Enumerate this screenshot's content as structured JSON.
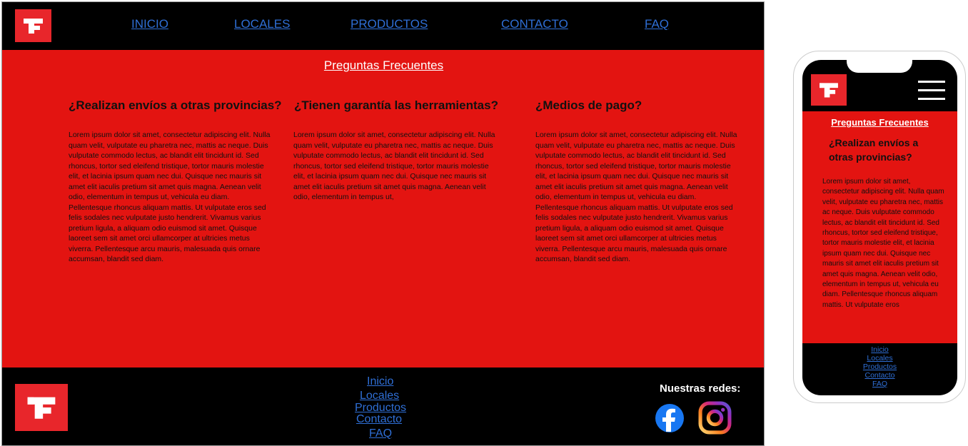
{
  "colors": {
    "brand_red": "#e31411",
    "logo_red": "#e8262b",
    "header_bg": "#000000",
    "link_blue": "#2f6fd6"
  },
  "nav": {
    "items": [
      "INICIO",
      "LOCALES",
      "PRODUCTOS",
      "CONTACTO",
      "FAQ"
    ]
  },
  "main": {
    "title": "Preguntas Frecuentes",
    "questions": [
      {
        "q": "¿Realizan envíos a otras provincias?",
        "a": "Lorem ipsum dolor sit amet, consectetur adipiscing elit. Nulla quam velit, vulputate eu pharetra nec, mattis ac neque. Duis vulputate commodo lectus, ac blandit elit tincidunt id. Sed rhoncus, tortor sed eleifend tristique, tortor mauris molestie elit, et lacinia ipsum quam nec dui. Quisque nec mauris sit amet elit iaculis pretium sit amet quis magna. Aenean velit odio, elementum in tempus ut, vehicula eu diam. Pellentesque rhoncus aliquam mattis. Ut vulputate eros sed felis sodales nec vulputate justo hendrerit. Vivamus varius pretium ligula, a aliquam odio euismod sit amet. Quisque laoreet sem sit amet orci ullamcorper at ultricies metus viverra. Pellentesque arcu mauris, malesuada quis ornare accumsan, blandit sed diam."
      },
      {
        "q": "¿Tienen garantía las herramientas?",
        "a": "Lorem ipsum dolor sit amet, consectetur adipiscing elit. Nulla quam velit, vulputate eu pharetra nec, mattis ac neque. Duis vulputate commodo lectus, ac blandit elit tincidunt id. Sed rhoncus, tortor sed eleifend tristique, tortor mauris molestie elit, et lacinia ipsum quam nec dui. Quisque nec mauris sit amet elit iaculis pretium sit amet quis magna. Aenean velit odio, elementum in tempus ut,"
      },
      {
        "q": "¿Medios de pago?",
        "a": "Lorem ipsum dolor sit amet, consectetur adipiscing elit. Nulla quam velit, vulputate eu pharetra nec, mattis ac neque. Duis vulputate commodo lectus, ac blandit elit tincidunt id. Sed rhoncus, tortor sed eleifend tristique, tortor mauris molestie elit, et lacinia ipsum quam nec dui. Quisque nec mauris sit amet elit iaculis pretium sit amet quis magna. Aenean velit odio, elementum in tempus ut, vehicula eu diam. Pellentesque rhoncus aliquam mattis. Ut vulputate eros sed felis sodales nec vulputate justo hendrerit. Vivamus varius pretium ligula, a aliquam odio euismod sit amet. Quisque laoreet sem sit amet orci ullamcorper at ultricies metus viverra. Pellentesque arcu mauris, malesuada quis ornare accumsan, blandit sed diam."
      }
    ]
  },
  "footer": {
    "links": [
      "Inicio",
      "Locales",
      "Productos",
      "Contacto",
      "FAQ"
    ],
    "social_label": "Nuestras redes:",
    "social_icons": [
      "facebook-icon",
      "instagram-icon"
    ]
  },
  "mobile": {
    "title": "Preguntas Frecuentes",
    "question": "¿Realizan envíos a otras provincias?",
    "answer": "Lorem ipsum dolor sit amet, consectetur adipiscing elit. Nulla quam velit, vulputate eu pharetra nec, mattis ac neque. Duis vulputate commodo lectus, ac blandit elit tincidunt id. Sed rhoncus, tortor sed eleifend tristique, tortor mauris molestie elit, et lacinia ipsum quam nec dui. Quisque nec mauris sit amet elit iaculis pretium sit amet quis magna. Aenean velit odio, elementum in tempus ut, vehicula eu diam. Pellentesque rhoncus aliquam mattis. Ut vulputate eros",
    "links": [
      "Inicio",
      "Locales",
      "Productos",
      "Contacto",
      "FAQ"
    ],
    "menu_icon": "hamburger-menu-icon"
  }
}
